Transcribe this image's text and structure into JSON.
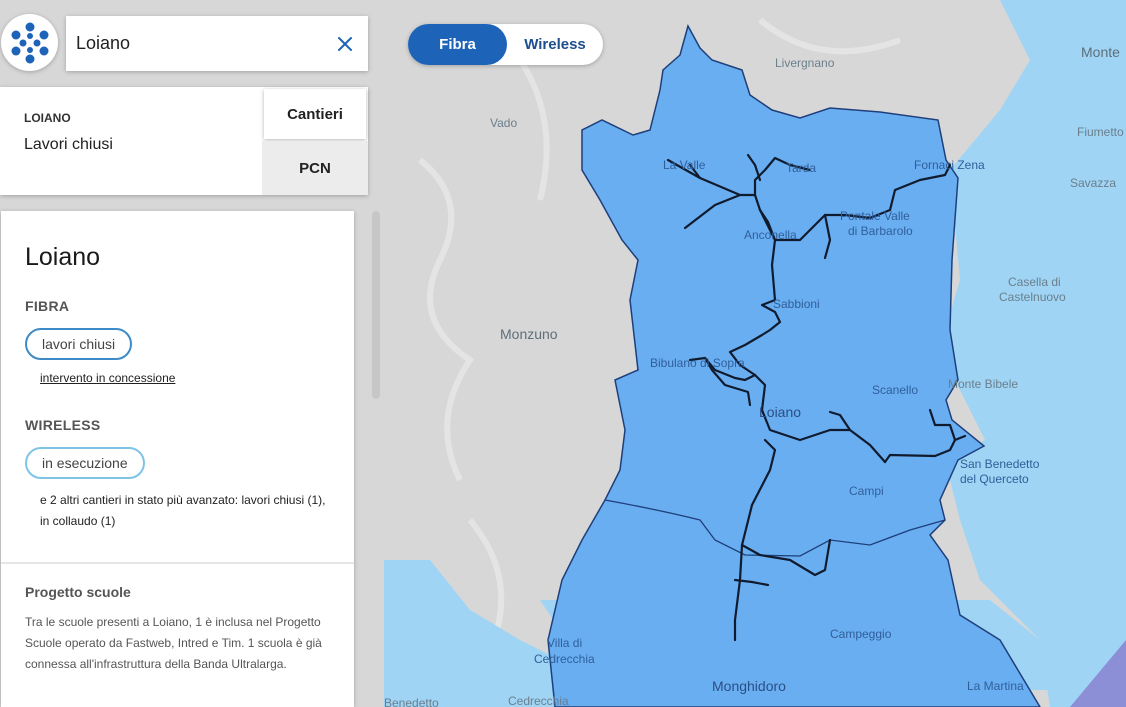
{
  "search": {
    "value": "Loiano",
    "placeholder": ""
  },
  "summary": {
    "municipality": "LOIANO",
    "status": "Lavori chiusi",
    "tabs": [
      "Cantieri",
      "PCN"
    ]
  },
  "detail": {
    "title": "Loiano",
    "fibra": {
      "heading": "FIBRA",
      "status": "lavori chiusi",
      "link": "intervento in concessione"
    },
    "wireless": {
      "heading": "WIRELESS",
      "status": "in esecuzione",
      "note": "e 2 altri cantieri in stato più avanzato: lavori chiusi (1), in collaudo (1)"
    },
    "project": {
      "title": "Progetto scuole",
      "text": "Tra le scuole presenti a Loiano, 1 è inclusa nel Progetto Scuole operato da Fastweb, Intred e Tim. 1 scuola è già connessa all'infrastruttura della Banda Ultralarga."
    }
  },
  "map_toggle": {
    "fibra": "Fibra",
    "wireless": "Wireless",
    "active": "Fibra"
  },
  "map_labels": {
    "livergnano": "Livergnano",
    "vado": "Vado",
    "monzuno": "Monzuno",
    "monte": "Monte",
    "fiumetto": "Fiumetto",
    "savazza": "Savazza",
    "fornaci": "Fornaci Zena",
    "la_valle": "La Valle",
    "pian_di_tarda": "Tarda",
    "anconella": "Anconella",
    "pianoro_vecchio": "Pontale Valle",
    "di_barbarolo": "di Barbarolo",
    "sabbioni": "Sabbioni",
    "bibulano": "Bibulano di Sopra",
    "scanello": "Scanello",
    "loiano": "Loiano",
    "casella_1": "Casella di",
    "casella_2": "Castelnuovo",
    "monte_bibele": "Monte Bibele",
    "san_benedetto_1": "San Benedetto",
    "san_benedetto_2": "del Querceto",
    "campi": "Campi",
    "villa_1": "Villa di",
    "villa_2": "Cedrecchia",
    "campeggio": "Campeggio",
    "monghidoro": "Monghidoro",
    "la_martina": "La Martina",
    "cedrecchia": "Cedrecchia",
    "benedetto": "Benedetto"
  },
  "colors": {
    "primary_blue": "#1d63b8",
    "fibra_area": "#6aaef2",
    "wireless_area": "#9fd4f5",
    "fibra_pill_border": "#3c8ac7",
    "wireless_pill_border": "#7ec4e6"
  }
}
